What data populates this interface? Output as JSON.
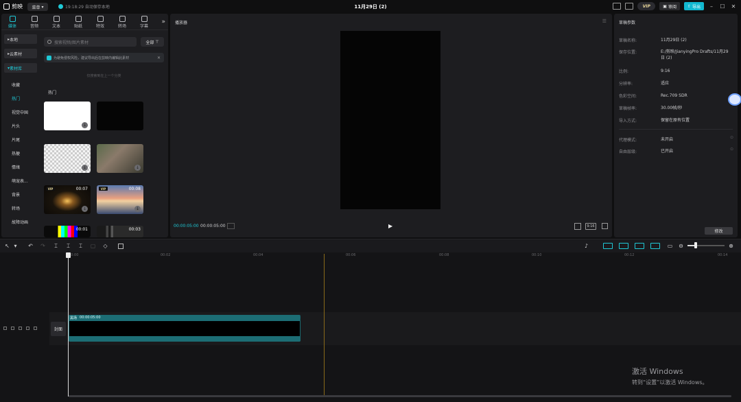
{
  "app": {
    "name": "剪映",
    "menu": "菜单",
    "autosave": "19:18:29 自动保存本地",
    "doc_title": "11月29日 (2)",
    "vip": "VIP",
    "share": "审阅",
    "export": "导出"
  },
  "tool_tabs": [
    {
      "label": "媒体"
    },
    {
      "label": "音频"
    },
    {
      "label": "文本"
    },
    {
      "label": "贴纸"
    },
    {
      "label": "特效"
    },
    {
      "label": "转场"
    },
    {
      "label": "字幕"
    }
  ],
  "media": {
    "nav": {
      "local": "本地",
      "cloud": "云素材",
      "library": "素材库"
    },
    "sub": [
      "收藏",
      "热门",
      "视觉中国",
      "片头",
      "片尾",
      "热梗",
      "情绪",
      "萌宠表...",
      "背景",
      "转场",
      "故障动画"
    ],
    "search_placeholder": "搜索视频/图片素材",
    "filter": "全部",
    "notice": "为避免侵权风险，建议导出后在剪映内编辑此素材",
    "hint": "仅搜索到在上一个分类",
    "section": "热门",
    "thumbs": [
      {
        "style": "white",
        "duration": "",
        "vip": false
      },
      {
        "style": "black",
        "duration": "",
        "vip": false
      },
      {
        "style": "check",
        "duration": "",
        "vip": false
      },
      {
        "style": "person",
        "duration": "",
        "vip": false
      },
      {
        "style": "ring",
        "duration": "00:07",
        "vip": true
      },
      {
        "style": "sunset",
        "duration": "00:08",
        "vip": true
      },
      {
        "style": "bars",
        "duration": "00:01",
        "vip": false
      },
      {
        "style": "film",
        "duration": "00:03",
        "vip": false
      }
    ]
  },
  "player": {
    "title": "播放器",
    "time_current": "00:00:05:00",
    "time_total": "00:00:05:00",
    "ratio": "9:16"
  },
  "draft": {
    "title": "草稿参数",
    "rows": [
      {
        "label": "草稿名称:",
        "value": "11月29日 (2)"
      },
      {
        "label": "保存位置:",
        "value": "E:/剪映/JianyingPro Drafts/11月29日 (2)"
      },
      {
        "label": "比例:",
        "value": "9:16"
      },
      {
        "label": "分辨率:",
        "value": "适应"
      },
      {
        "label": "色彩空间:",
        "value": "Rec.709 SDR"
      },
      {
        "label": "草稿帧率:",
        "value": "30.00帧/秒"
      },
      {
        "label": "导入方式:",
        "value": "保留在原有位置"
      }
    ],
    "rows2": [
      {
        "label": "代理模式:",
        "value": "未开启"
      },
      {
        "label": "自由层级:",
        "value": "已开启"
      }
    ],
    "modify": "修改"
  },
  "timeline": {
    "ruler": [
      "00:00",
      "00:02",
      "00:04",
      "00:06",
      "00:08",
      "00:10",
      "00:12",
      "00:14"
    ],
    "cover": "封面",
    "clip": {
      "name": "黑场",
      "duration": "00:00:05:00"
    }
  },
  "watermark": {
    "line1": "激活 Windows",
    "line2": "转到“设置”以激活 Windows。"
  }
}
